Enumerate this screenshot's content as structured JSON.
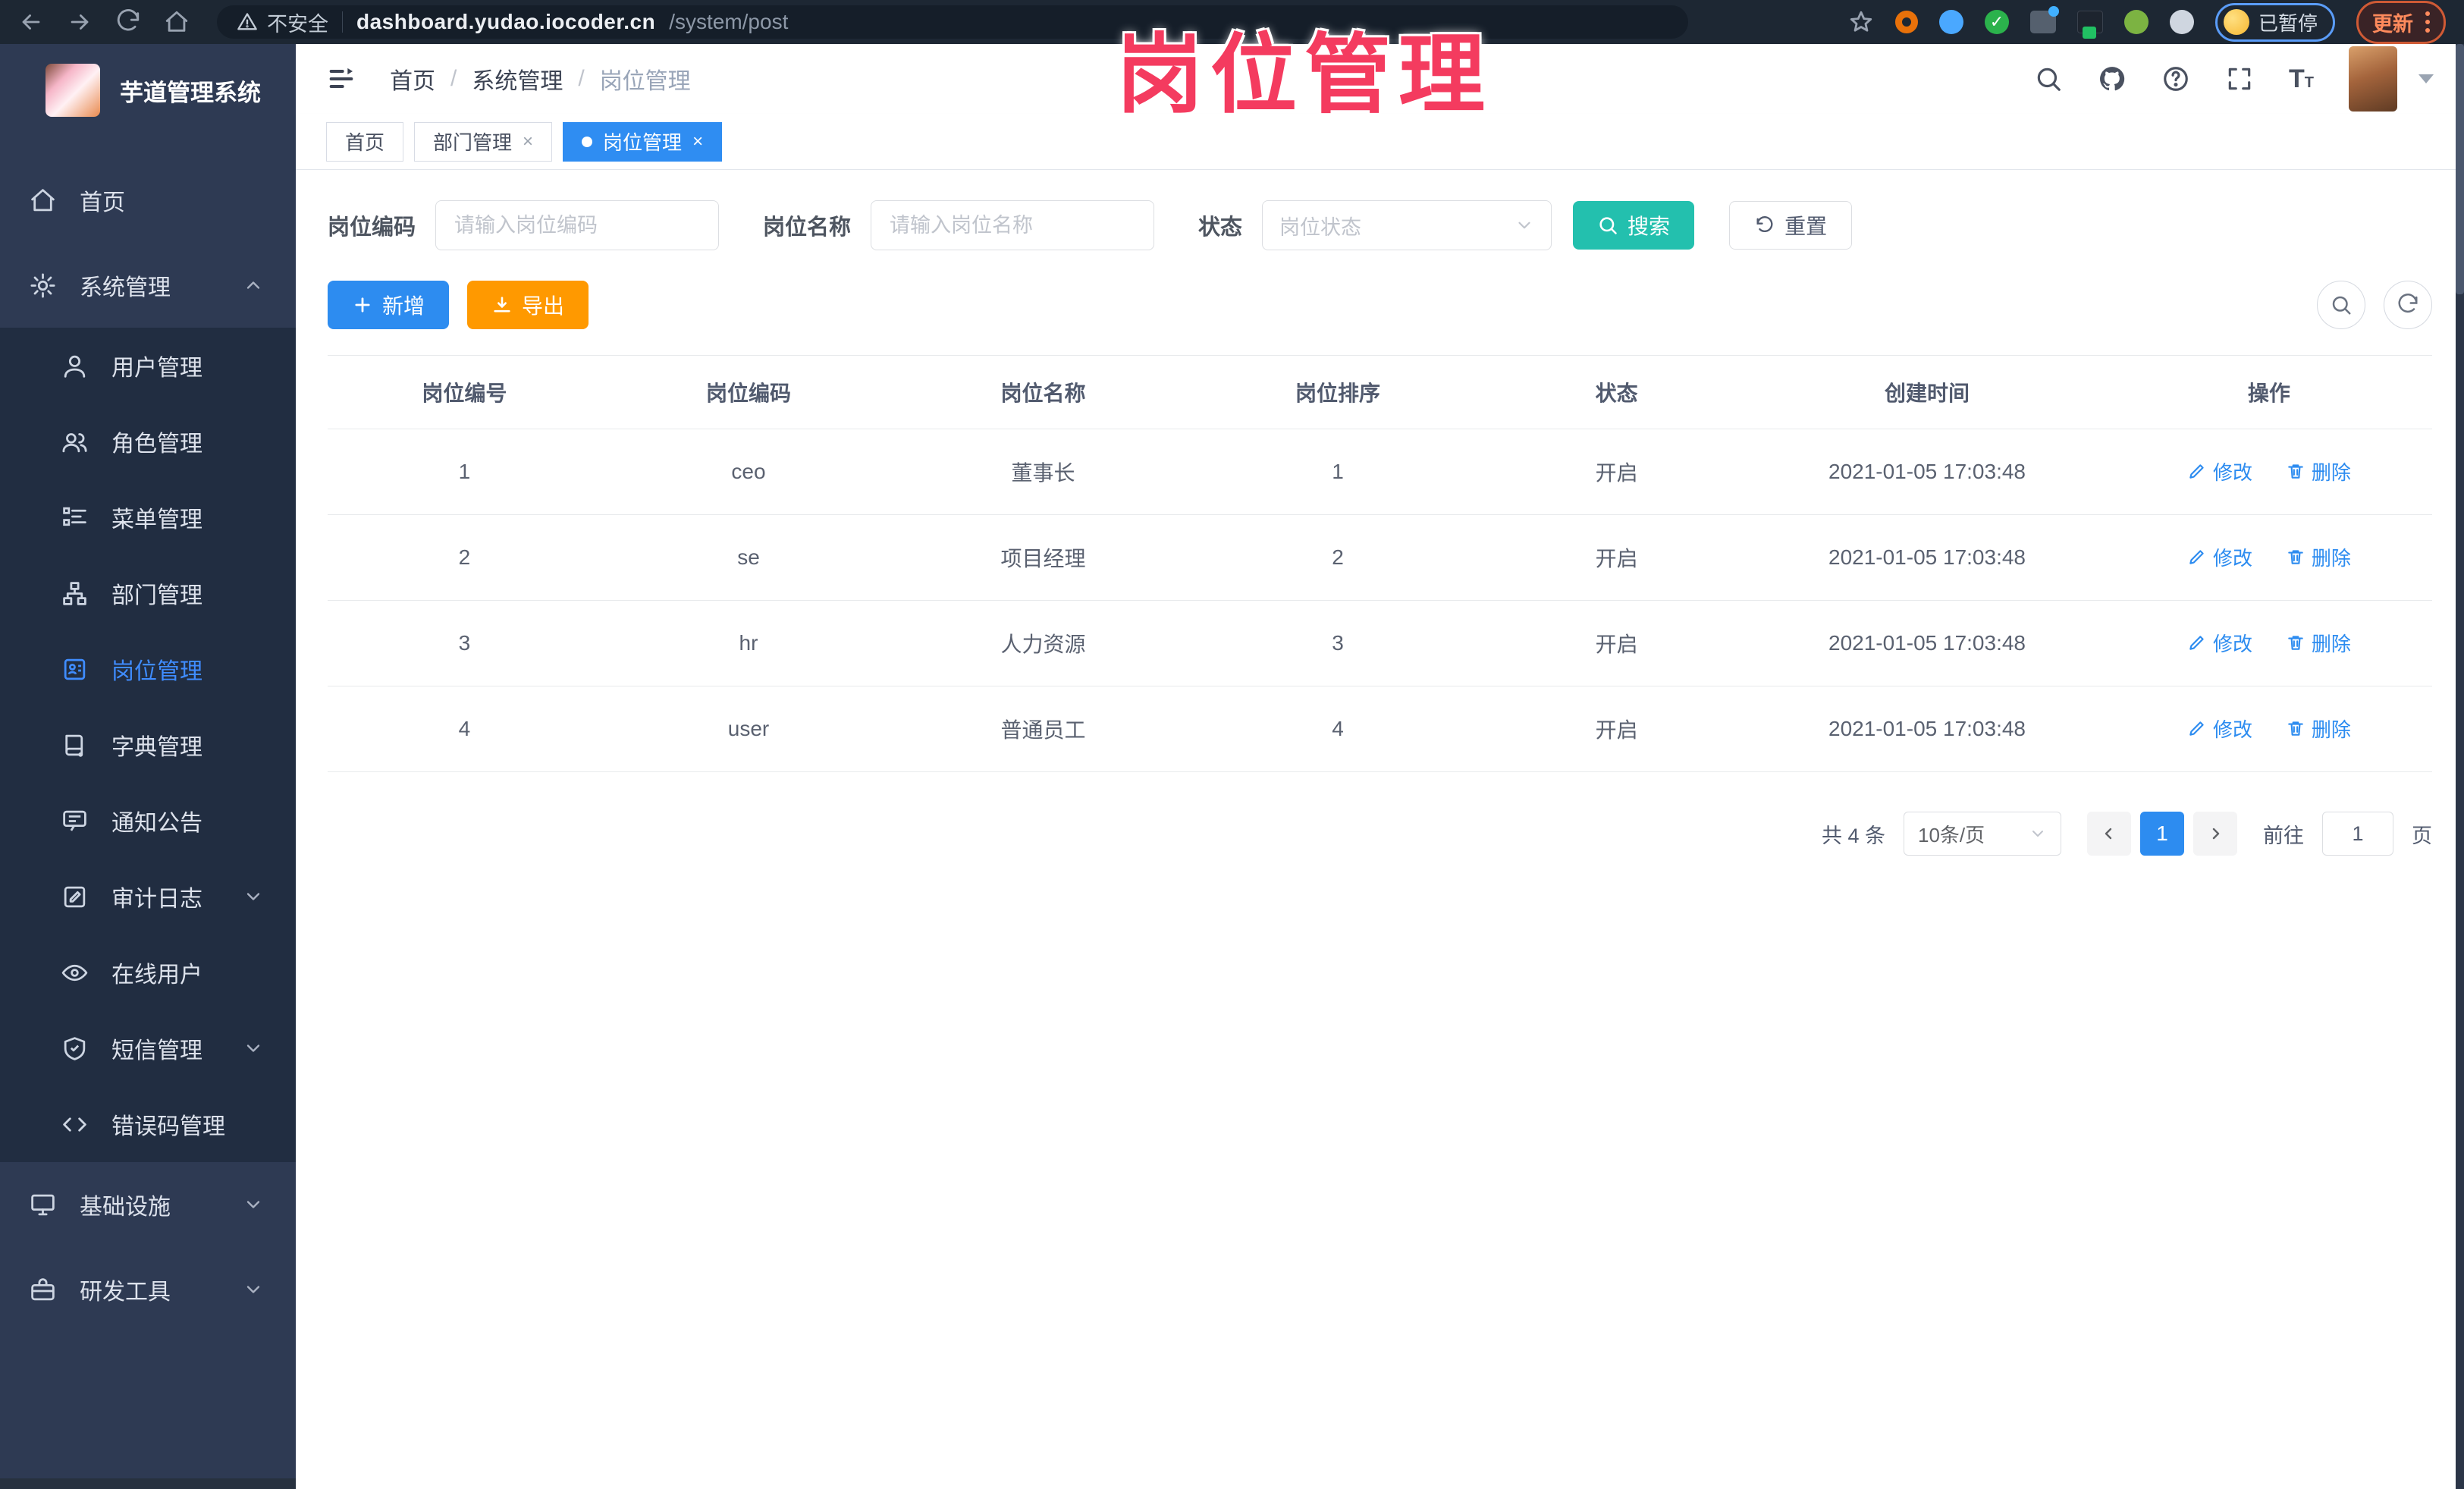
{
  "browser": {
    "security": "不安全",
    "host": "dashboard.yudao.iocoder.cn",
    "path": "/system/post",
    "paused_badge": "已暂停",
    "update_label": "更新"
  },
  "annotation": {
    "text": "岗位管理"
  },
  "colors": {
    "primary_blue": "#2d8cf0",
    "search_teal": "#23c0ae",
    "export_orange": "#ff9900",
    "annotation_pink": "#f43b5f",
    "sidebar_bg": "#2e3a53",
    "submenu_bg": "#212d41",
    "browser_bar_bg": "#1d2733",
    "active_menu_blue": "#3f8cff"
  },
  "sidebar": {
    "logo_title": "芋道管理系统",
    "items": [
      {
        "label": "首页"
      },
      {
        "label": "系统管理"
      },
      {
        "label": "用户管理"
      },
      {
        "label": "角色管理"
      },
      {
        "label": "菜单管理"
      },
      {
        "label": "部门管理"
      },
      {
        "label": "岗位管理"
      },
      {
        "label": "字典管理"
      },
      {
        "label": "通知公告"
      },
      {
        "label": "审计日志"
      },
      {
        "label": "在线用户"
      },
      {
        "label": "短信管理"
      },
      {
        "label": "错误码管理"
      },
      {
        "label": "基础设施"
      },
      {
        "label": "研发工具"
      }
    ]
  },
  "header": {
    "crumbs": [
      "首页",
      "系统管理",
      "岗位管理"
    ]
  },
  "tabs": [
    {
      "label": "首页"
    },
    {
      "label": "部门管理"
    },
    {
      "label": "岗位管理"
    }
  ],
  "filters": {
    "code_label": "岗位编码",
    "code_placeholder": "请输入岗位编码",
    "name_label": "岗位名称",
    "name_placeholder": "请输入岗位名称",
    "status_label": "状态",
    "status_placeholder": "岗位状态",
    "search_label": "搜索",
    "reset_label": "重置"
  },
  "toolbar": {
    "add_label": "新增",
    "export_label": "导出"
  },
  "table": {
    "columns": [
      "岗位编号",
      "岗位编码",
      "岗位名称",
      "岗位排序",
      "状态",
      "创建时间",
      "操作"
    ],
    "rows": [
      {
        "id": "1",
        "code": "ceo",
        "name": "董事长",
        "sort": "1",
        "status": "开启",
        "created": "2021-01-05 17:03:48"
      },
      {
        "id": "2",
        "code": "se",
        "name": "项目经理",
        "sort": "2",
        "status": "开启",
        "created": "2021-01-05 17:03:48"
      },
      {
        "id": "3",
        "code": "hr",
        "name": "人力资源",
        "sort": "3",
        "status": "开启",
        "created": "2021-01-05 17:03:48"
      },
      {
        "id": "4",
        "code": "user",
        "name": "普通员工",
        "sort": "4",
        "status": "开启",
        "created": "2021-01-05 17:03:48"
      }
    ],
    "edit_label": "修改",
    "delete_label": "删除"
  },
  "pagination": {
    "total": "共 4 条",
    "page_size": "10条/页",
    "current_page": "1",
    "goto_label": "前往",
    "goto_value": "1",
    "unit_label": "页"
  }
}
